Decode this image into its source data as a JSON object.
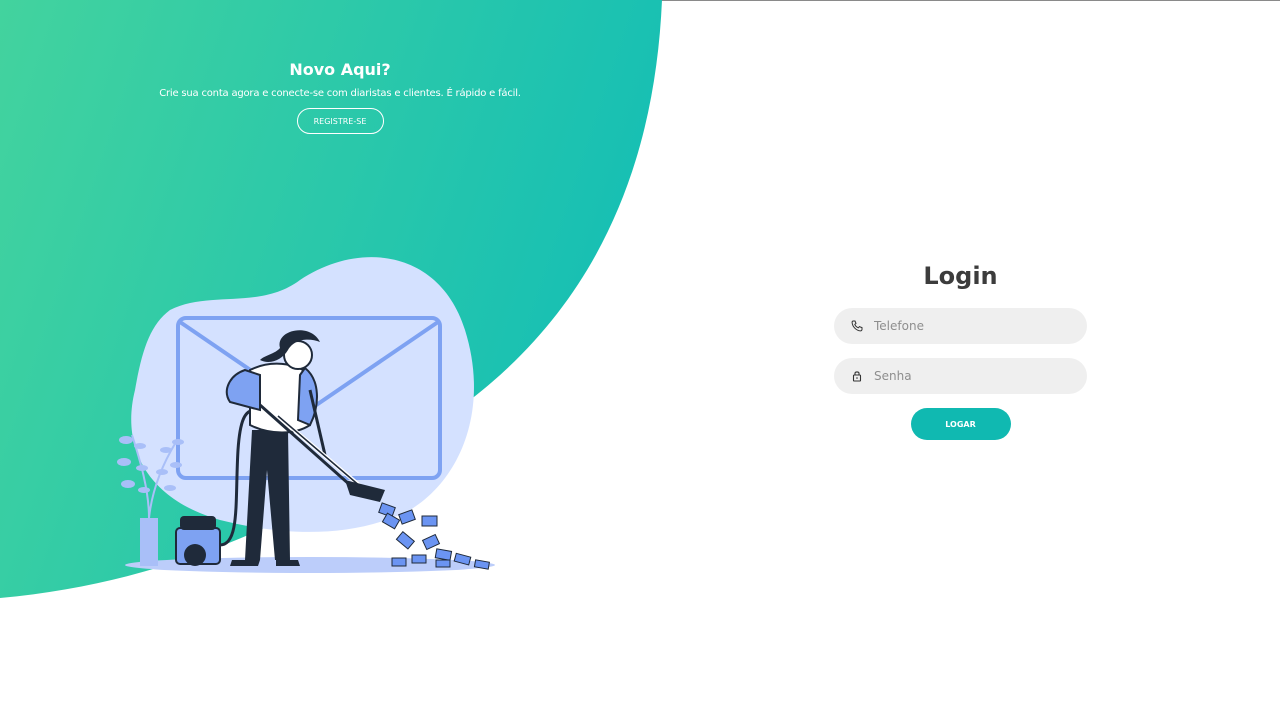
{
  "colors": {
    "gradient_start": "#43d39e",
    "gradient_end": "#16bfb4",
    "button": "#10b9b1",
    "illustration_blob": "#d4e1ff",
    "illustration_accent": "#6b94f2"
  },
  "signup_panel": {
    "title": "Novo Aqui?",
    "description": "Crie sua conta agora e conecte-se com diaristas e clientes. É rápido e fácil.",
    "register_label": "REGISTRE-SE"
  },
  "illustration": {
    "icon": "woman-vacuuming-envelopes-illustration"
  },
  "login": {
    "title": "Login",
    "phone": {
      "icon": "phone-icon",
      "placeholder": "Telefone",
      "value": ""
    },
    "password": {
      "icon": "lock-icon",
      "placeholder": "Senha",
      "value": ""
    },
    "submit_label": "LOGAR"
  }
}
